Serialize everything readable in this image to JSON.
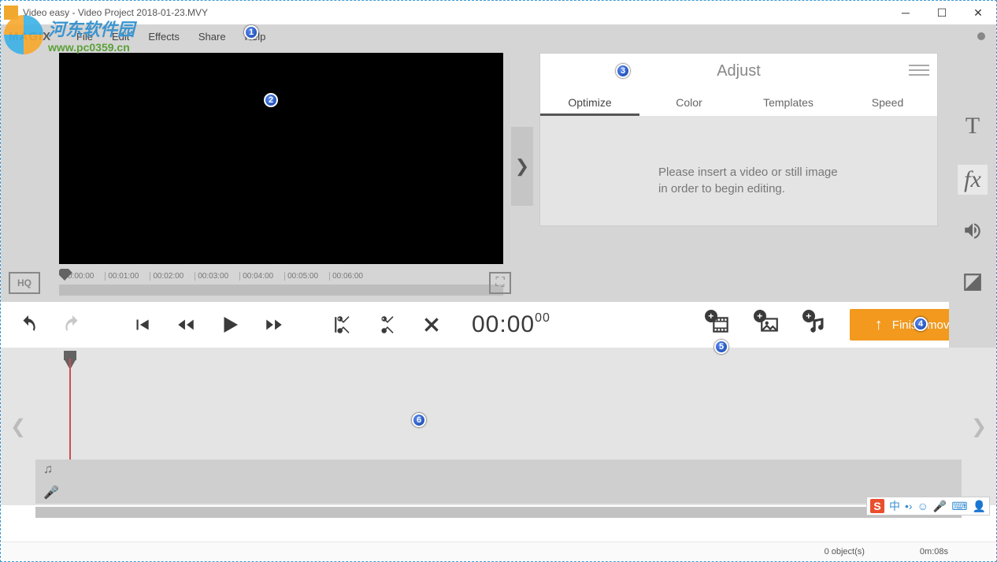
{
  "window": {
    "title": "Video easy - Video Project 2018-01-23.MVY"
  },
  "watermark": {
    "cn": "河东软件园",
    "url": "www.pc0359.cn"
  },
  "brand": "MAGIX",
  "menu": {
    "file": "File",
    "edit": "Edit",
    "effects": "Effects",
    "share": "Share",
    "help": "Help"
  },
  "ruler": {
    "t0": "0:00:00",
    "t1": "00:01:00",
    "t2": "00:02:00",
    "t3": "00:03:00",
    "t4": "00:04:00",
    "t5": "00:05:00",
    "t6": "00:06:00"
  },
  "hq_label": "HQ",
  "adjust_panel": {
    "title": "Adjust",
    "tabs": {
      "optimize": "Optimize",
      "color": "Color",
      "templates": "Templates",
      "speed": "Speed"
    },
    "message": "Please insert a video or still image in order to begin editing."
  },
  "side_tools": {
    "text": "T",
    "fx": "fx"
  },
  "transport": {
    "timecode_main": "00:00",
    "timecode_frames": "00",
    "finish_label": "Finish movie"
  },
  "status": {
    "objects": "0 object(s)",
    "duration": "0m:08s"
  },
  "ime": {
    "zhong": "中"
  },
  "callouts": {
    "c1": "1",
    "c2": "2",
    "c3": "3",
    "c4": "4",
    "c5": "5",
    "c6": "6"
  }
}
